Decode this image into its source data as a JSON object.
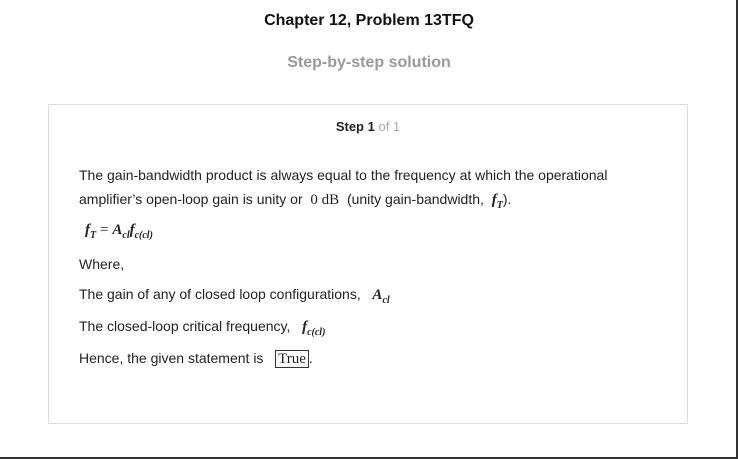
{
  "header": {
    "chapter_title": "Chapter 12, Problem 13TFQ",
    "subtitle": "Step-by-step solution"
  },
  "step": {
    "label": "Step 1",
    "of": "of 1"
  },
  "content": {
    "line1": "The gain-bandwidth product is always equal to the frequency at which the operational",
    "line2_a": "amplifier’s open-loop gain is unity or",
    "line2_math": "0 dB",
    "line2_b": "(unity gain-bandwidth,",
    "line2_c": ").",
    "eq_fT": "f",
    "eq_fT_sub": "T",
    "eq_equals": "=",
    "eq_A": "A",
    "eq_A_sub": "cl",
    "eq_f": "f",
    "eq_f_sub": "c(cl)",
    "where": "Where,",
    "gain_text": "The gain of any of closed loop configurations,",
    "freq_text": "The closed-loop critical frequency,",
    "hence_text": "Hence, the given statement is",
    "answer": "True",
    "hence_end": "."
  }
}
